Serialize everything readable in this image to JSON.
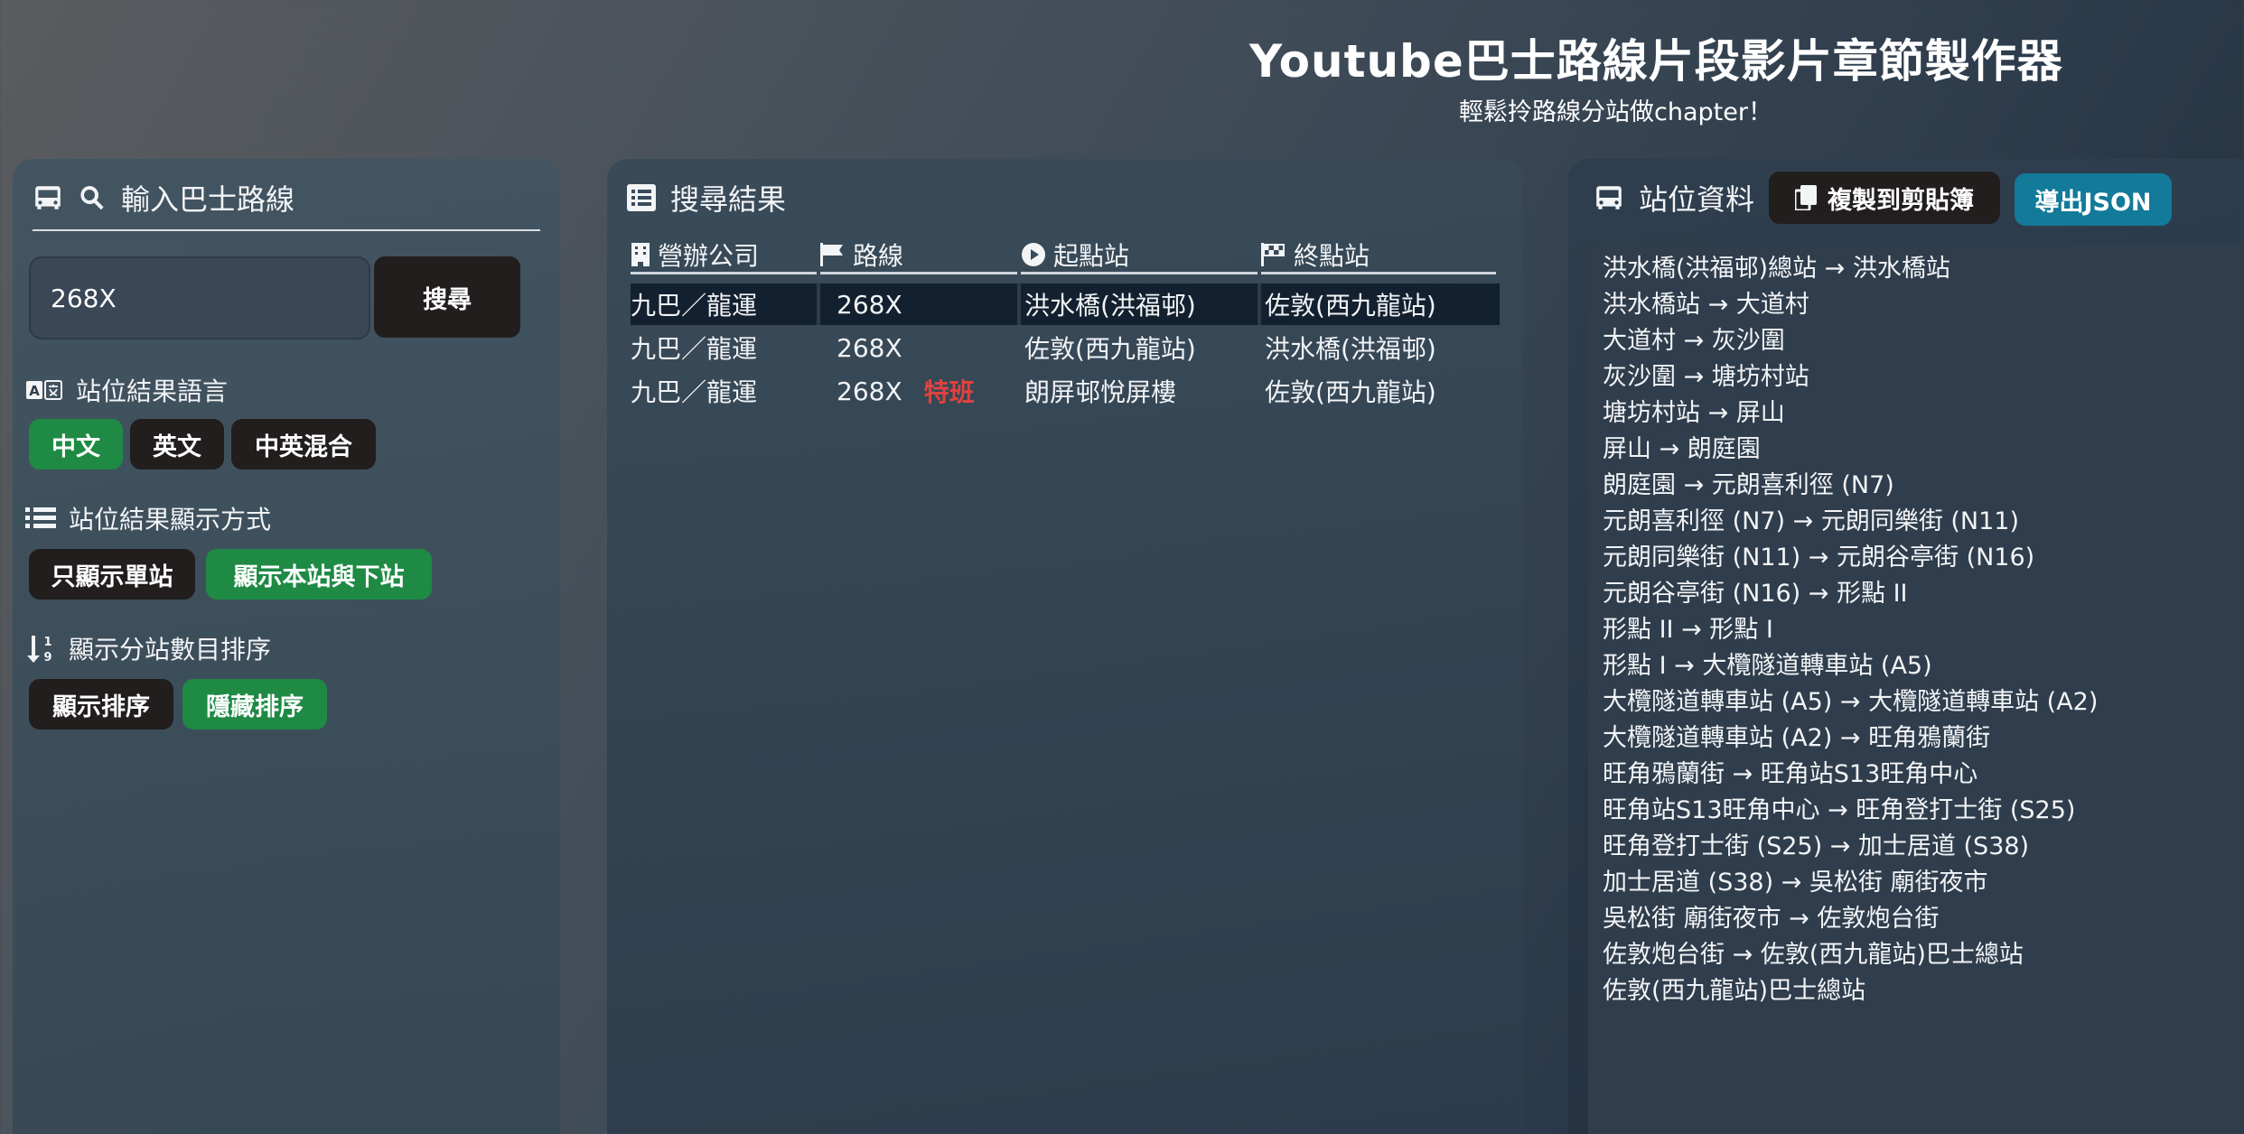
{
  "header": {
    "title": "Youtube巴士路線片段影片章節製作器",
    "subtitle": "輕鬆拎路線分站做chapter！"
  },
  "left": {
    "title": "輸入巴士路線",
    "search": {
      "value": "268X",
      "button": "搜尋"
    },
    "language": {
      "label": "站位結果語言",
      "options": [
        "中文",
        "英文",
        "中英混合"
      ],
      "selected": "中文"
    },
    "display": {
      "label": "站位結果顯示方式",
      "options": [
        "只顯示單站",
        "顯示本站與下站"
      ],
      "selected": "顯示本站與下站"
    },
    "sort": {
      "label": "顯示分站數目排序",
      "options": [
        "顯示排序",
        "隱藏排序"
      ],
      "selected": "隱藏排序"
    }
  },
  "results": {
    "title": "搜尋結果",
    "columns": [
      "營辦公司",
      "路線",
      "起點站",
      "終點站"
    ],
    "rows": [
      {
        "company": "九巴／龍運",
        "route": "268X",
        "tag": "",
        "origin": "洪水橋(洪福邨)",
        "destination": "佐敦(西九龍站)",
        "selected": true
      },
      {
        "company": "九巴／龍運",
        "route": "268X",
        "tag": "",
        "origin": "佐敦(西九龍站)",
        "destination": "洪水橋(洪福邨)",
        "selected": false
      },
      {
        "company": "九巴／龍運",
        "route": "268X",
        "tag": "特班",
        "origin": "朗屏邨悅屏樓",
        "destination": "佐敦(西九龍站)",
        "selected": false
      }
    ]
  },
  "stops": {
    "title": "站位資料",
    "copy_button": "複製到剪貼簿",
    "export_button": "導出JSON",
    "items": [
      "洪水橋(洪福邨)總站 → 洪水橋站",
      "洪水橋站 → 大道村",
      "大道村 → 灰沙圍",
      "灰沙圍 → 塘坊村站",
      "塘坊村站 → 屏山",
      "屏山 → 朗庭園",
      "朗庭園 → 元朗喜利徑 (N7)",
      "元朗喜利徑 (N7) → 元朗同樂街 (N11)",
      "元朗同樂街 (N11) → 元朗谷亭街 (N16)",
      "元朗谷亭街 (N16) → 形點 II",
      "形點 II → 形點 I",
      "形點 I → 大欖隧道轉車站 (A5)",
      "大欖隧道轉車站 (A5) → 大欖隧道轉車站 (A2)",
      "大欖隧道轉車站 (A2) → 旺角鴉蘭街",
      "旺角鴉蘭街 → 旺角站S13旺角中心",
      "旺角站S13旺角中心 → 旺角登打士街 (S25)",
      "旺角登打士街 (S25) → 加士居道 (S38)",
      "加士居道 (S38) → 吳松街 廟街夜市",
      "吳松街 廟街夜市 → 佐敦炮台街",
      "佐敦炮台街 → 佐敦(西九龍站)巴士總站",
      "佐敦(西九龍站)巴士總站"
    ]
  },
  "colors": {
    "selected_green": "#1e8a44",
    "dark_button": "#211e1d",
    "export_teal": "#137a9a",
    "special_red": "#e0423e"
  }
}
